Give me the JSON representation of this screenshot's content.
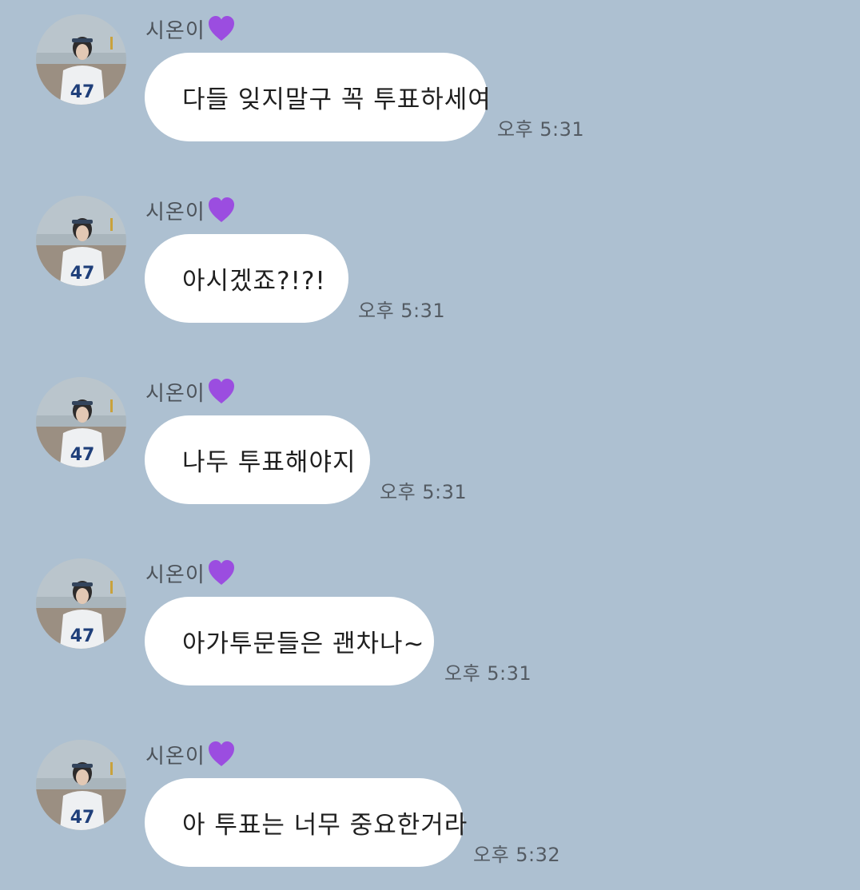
{
  "chat": {
    "messages": [
      {
        "sender": "시온이",
        "text": "다들 잊지말구 꼭 투표하세여",
        "time": "오후 5:31"
      },
      {
        "sender": "시온이",
        "text": "아시겠죠?!?!",
        "time": "오후 5:31"
      },
      {
        "sender": "시온이",
        "text": "나두 투표해야지",
        "time": "오후 5:31"
      },
      {
        "sender": "시온이",
        "text": "아가투문들은 괜차나~",
        "time": "오후 5:31"
      },
      {
        "sender": "시온이",
        "text": "아 투표는 너무 중요한거라",
        "time": "오후 5:32"
      }
    ]
  },
  "icons": {
    "sender_badge": "purple-heart-icon",
    "avatar": "profile-photo-avatar"
  },
  "colors": {
    "background": "#adc0d1",
    "bubble": "#ffffff",
    "heart": "#9b4de0"
  }
}
